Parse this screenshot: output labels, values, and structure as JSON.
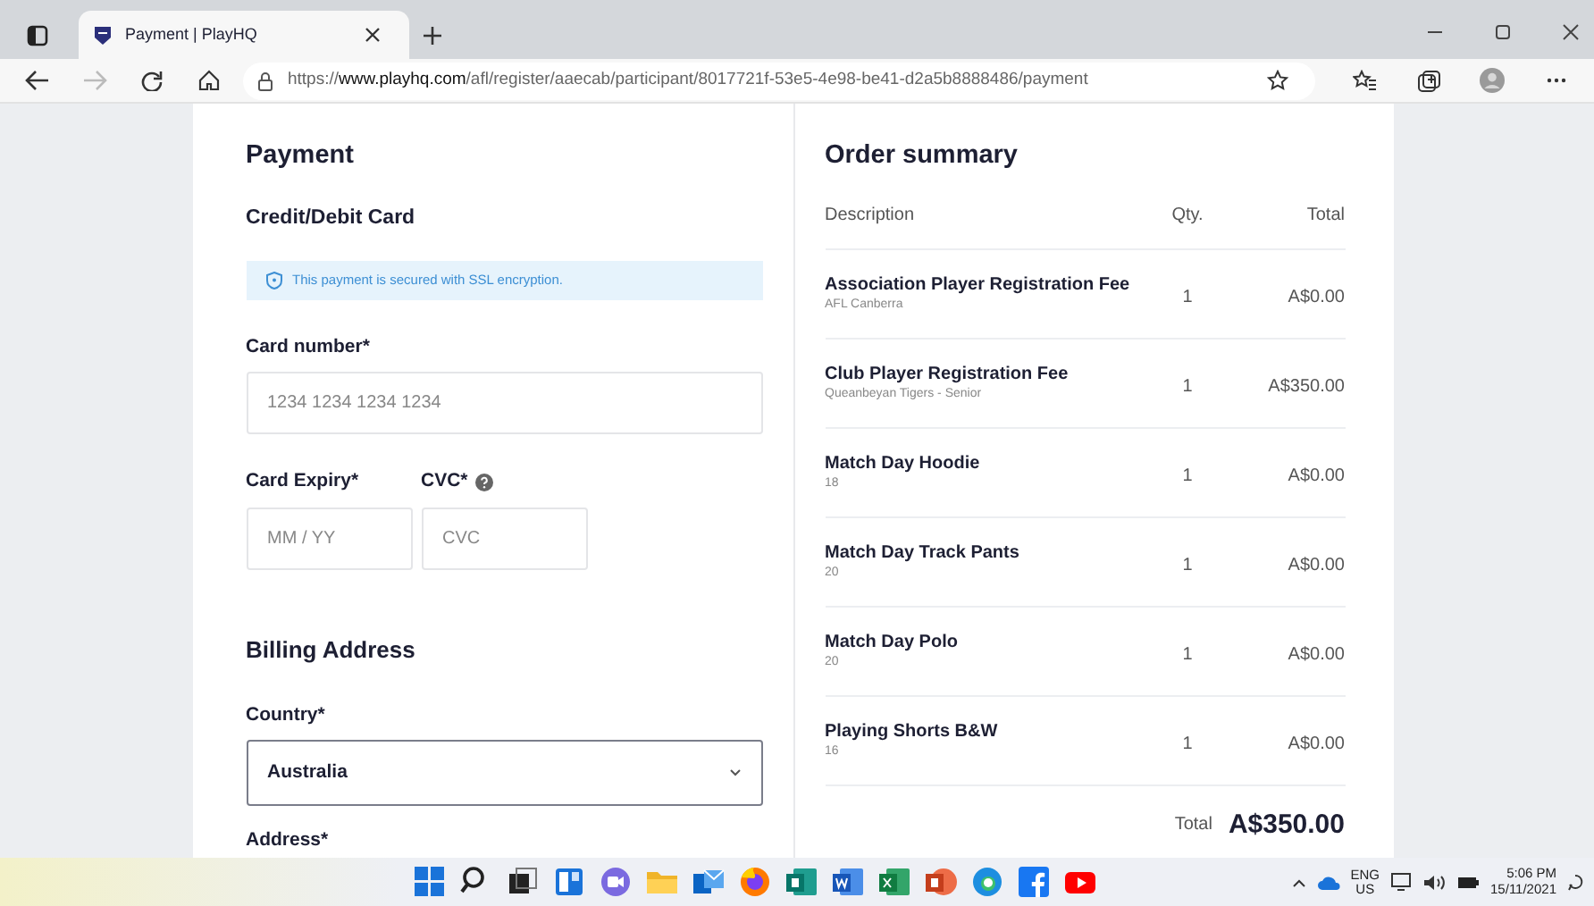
{
  "browser": {
    "tab_title": "Payment | PlayHQ",
    "url": {
      "scheme": "https://",
      "host": "www.playhq.com",
      "path": "/afl/register/aaecab/participant/8017721f-53e5-4e98-be41-d2a5b8888486/payment"
    }
  },
  "payment": {
    "title": "Payment",
    "method": "Credit/Debit Card",
    "notice": "This payment is secured with SSL encryption.",
    "card_number": {
      "label": "Card number*",
      "placeholder": "1234 1234 1234 1234"
    },
    "expiry": {
      "label": "Card Expiry*",
      "placeholder": "MM / YY"
    },
    "cvc": {
      "label": "CVC*",
      "placeholder": "CVC"
    },
    "billing_title": "Billing Address",
    "country": {
      "label": "Country*",
      "value": "Australia"
    },
    "address": {
      "label": "Address*"
    }
  },
  "order": {
    "title": "Order summary",
    "columns": [
      "Description",
      "Qty.",
      "Total"
    ],
    "items": [
      {
        "name": "Association Player Registration Fee",
        "detail": "AFL Canberra",
        "qty": "1",
        "total": "A$0.00"
      },
      {
        "name": "Club Player Registration Fee",
        "detail": "Queanbeyan Tigers - Senior",
        "qty": "1",
        "total": "A$350.00"
      },
      {
        "name": "Match Day Hoodie",
        "detail": "18",
        "qty": "1",
        "total": "A$0.00"
      },
      {
        "name": "Match Day Track Pants",
        "detail": "20",
        "qty": "1",
        "total": "A$0.00"
      },
      {
        "name": "Match Day Polo",
        "detail": "20",
        "qty": "1",
        "total": "A$0.00"
      },
      {
        "name": "Playing Shorts B&W",
        "detail": "16",
        "qty": "1",
        "total": "A$0.00"
      }
    ],
    "total_label": "Total",
    "total": "A$350.00"
  },
  "taskbar": {
    "language": "ENG",
    "region": "US",
    "time": "5:06 PM",
    "date": "15/11/2021"
  }
}
